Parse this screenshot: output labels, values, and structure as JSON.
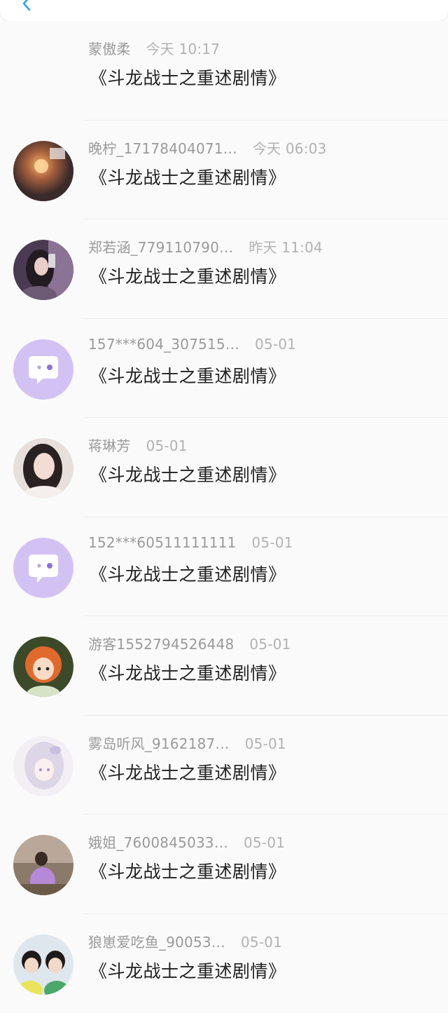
{
  "header": {
    "back_icon": "chevron-left-icon"
  },
  "colors": {
    "back": "#2aa3f5",
    "bot_avatar_bg": "#d2c2f3",
    "name": "#9a9a9a",
    "message": "#222222"
  },
  "messages": [
    {
      "name": "蒙傲柔",
      "time": "今天 10:17",
      "text": "《斗龙战士之重述剧情》",
      "avatar": "none"
    },
    {
      "name": "晚柠_17178404071…",
      "time": "今天 06:03",
      "text": "《斗龙战士之重述剧情》",
      "avatar": "photo-candle"
    },
    {
      "name": "郑若涵_779110790…",
      "time": "昨天 11:04",
      "text": "《斗龙战士之重述剧情》",
      "avatar": "photo-selfie"
    },
    {
      "name": "157***604_307515…",
      "time": "05-01",
      "text": "《斗龙战士之重述剧情》",
      "avatar": "chat-bubble-icon"
    },
    {
      "name": "蒋琳芳",
      "time": "05-01",
      "text": "《斗龙战士之重述剧情》",
      "avatar": "photo-girl"
    },
    {
      "name": "152***60511111111",
      "time": "05-01",
      "text": "《斗龙战士之重述剧情》",
      "avatar": "chat-bubble-icon"
    },
    {
      "name": "游客1552794526448",
      "time": "05-01",
      "text": "《斗龙战士之重述剧情》",
      "avatar": "anime-redhead"
    },
    {
      "name": "雾岛听风_9162187…",
      "time": "05-01",
      "text": "《斗龙战士之重述剧情》",
      "avatar": "anime-white-hair"
    },
    {
      "name": "娥姐_7600845033…",
      "time": "05-01",
      "text": "《斗龙战士之重述剧情》",
      "avatar": "photo-outdoor"
    },
    {
      "name": "狼崽爱吃鱼_90053…",
      "time": "05-01",
      "text": "《斗龙战士之重述剧情》",
      "avatar": "photo-two-boys"
    }
  ]
}
